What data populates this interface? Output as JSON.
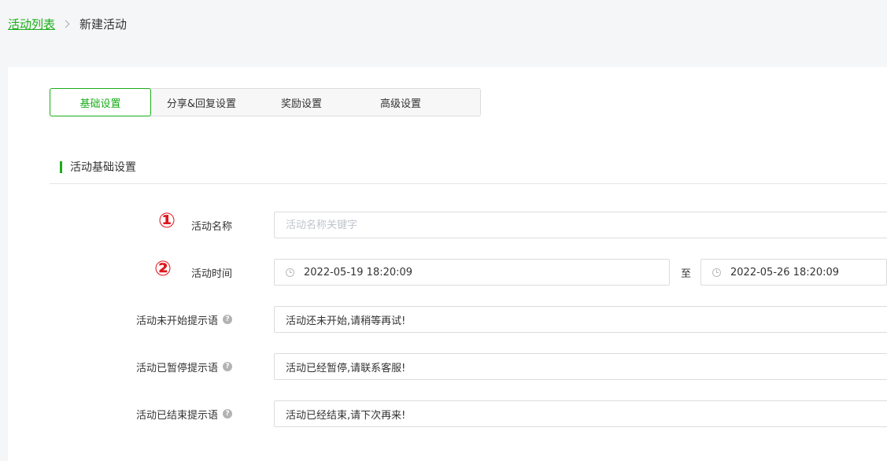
{
  "breadcrumb": {
    "parent": "活动列表",
    "current": "新建活动"
  },
  "tabs": [
    {
      "label": "基础设置",
      "active": true
    },
    {
      "label": "分享&回复设置",
      "active": false
    },
    {
      "label": "奖励设置",
      "active": false
    },
    {
      "label": "高级设置",
      "active": false
    }
  ],
  "section": {
    "title": "活动基础设置"
  },
  "annotations": {
    "one": "①",
    "two": "②"
  },
  "form": {
    "name": {
      "label": "活动名称",
      "placeholder": "活动名称关键字",
      "value": ""
    },
    "time": {
      "label": "活动时间",
      "start": "2022-05-19 18:20:09",
      "separator": "至",
      "end": "2022-05-26 18:20:09"
    },
    "not_started": {
      "label": "活动未开始提示语",
      "value": "活动还未开始,请稍等再试!"
    },
    "paused": {
      "label": "活动已暂停提示语",
      "value": "活动已经暂停,请联系客服!"
    },
    "ended": {
      "label": "活动已结束提示语",
      "value": "活动已经结束,请下次再来!"
    },
    "help_glyph": "?"
  },
  "colors": {
    "accent": "#1aad19",
    "annotation": "#e0161d"
  }
}
